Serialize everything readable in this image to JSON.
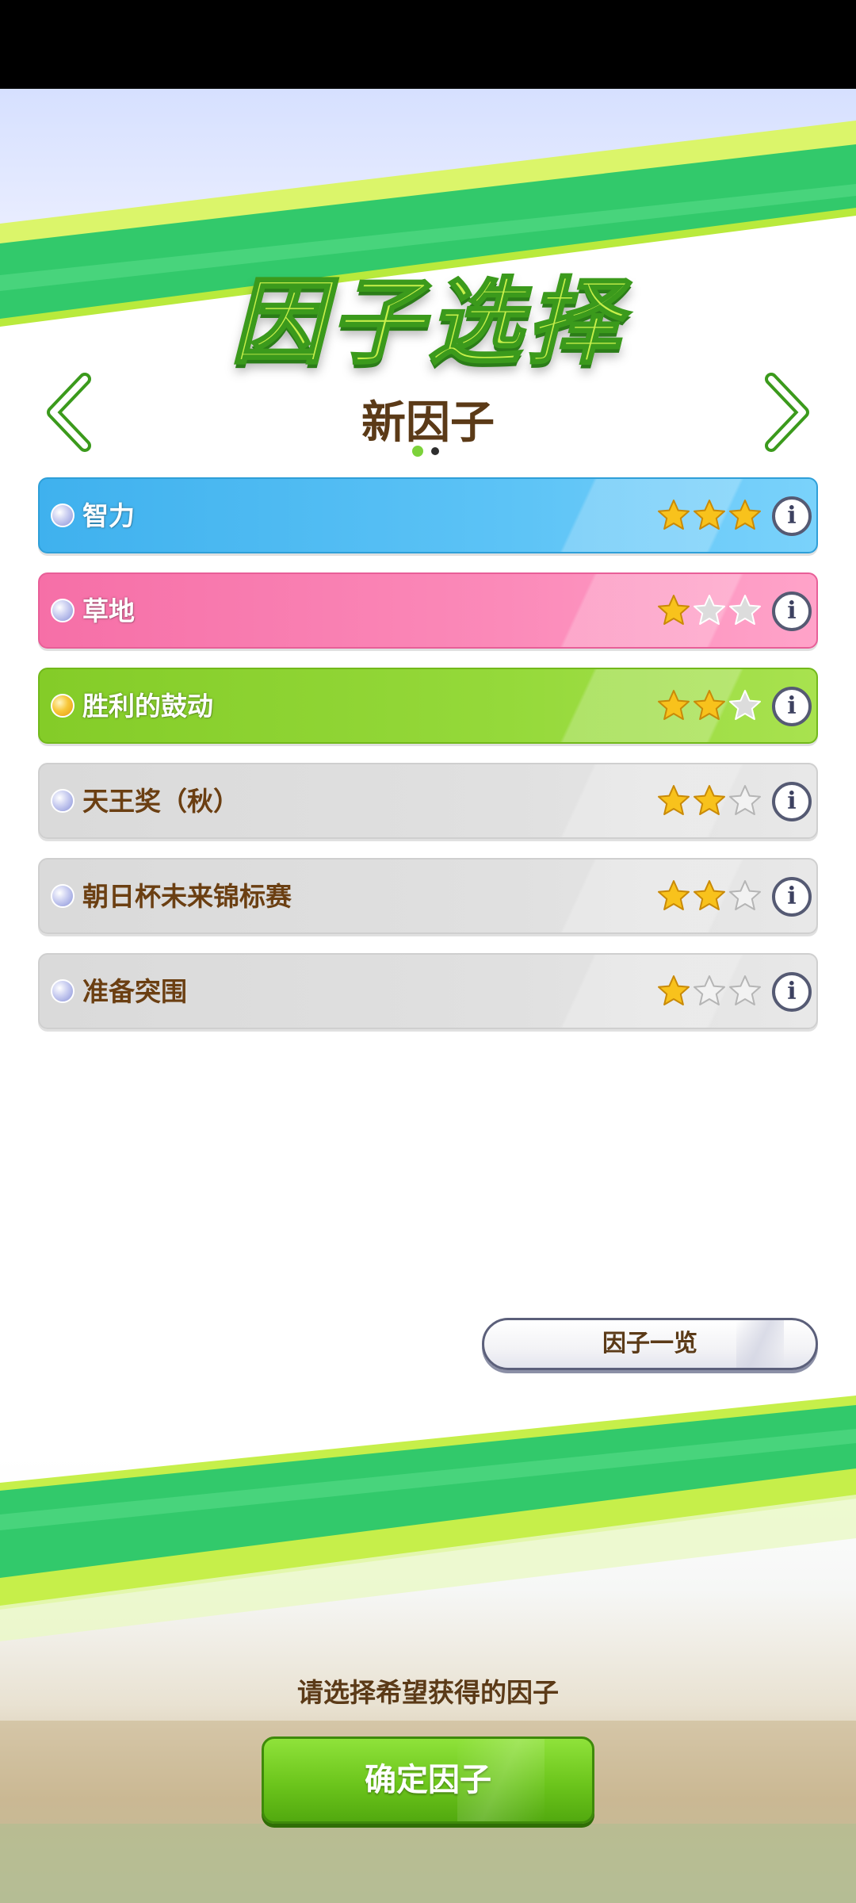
{
  "header": {
    "title": "因子选择",
    "subtitle": "新因子",
    "page_indicator": {
      "current": 1,
      "total": 2
    }
  },
  "factors": [
    {
      "label": "智力",
      "stars": 3,
      "max_stars": 3,
      "color": "#3fb1ee",
      "gem": "silver-gem"
    },
    {
      "label": "草地",
      "stars": 1,
      "max_stars": 3,
      "color": "#f66fa7",
      "gem": "silver-gem"
    },
    {
      "label": "胜利的鼓动",
      "stars": 2,
      "max_stars": 3,
      "color": "#84cc28",
      "gem": "gold-gem"
    },
    {
      "label": "天王奖（秋）",
      "stars": 2,
      "max_stars": 3,
      "color": "#dadada",
      "gem": "silver-gem"
    },
    {
      "label": "朝日杯未来锦标赛",
      "stars": 2,
      "max_stars": 3,
      "color": "#dadada",
      "gem": "silver-gem"
    },
    {
      "label": "准备突围",
      "stars": 1,
      "max_stars": 3,
      "color": "#dadada",
      "gem": "silver-gem"
    }
  ],
  "info_icon": "info-circle-icon",
  "buttons": {
    "factor_list": "因子一览",
    "confirm": "确定因子"
  },
  "prompt": "请选择希望获得的因子",
  "colors": {
    "title_fill": "#c8f04a",
    "accent_green": "#7cd23a",
    "text_brown": "#5b3a17",
    "star_gold": "#f8c21c"
  }
}
